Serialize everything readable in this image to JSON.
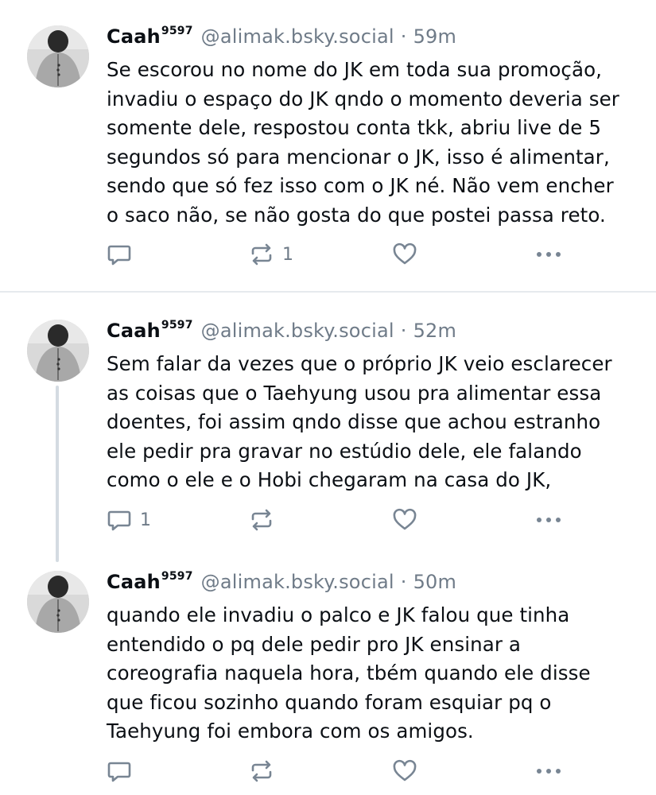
{
  "posts": [
    {
      "author_name": "Caah",
      "author_superscript": "9597",
      "handle": "@alimak.bsky.social",
      "separator": "·",
      "time": "59m",
      "lines": [
        "Se escorou no nome do JK em toda sua promoção,",
        "invadiu o espaço do JK qndo o momento deveria ser",
        "somente dele, respostou conta tkk, abriu live de 5",
        "segundos só para mencionar o JK, isso é alimentar,",
        "sendo que só fez isso com o JK né. Não vem encher",
        "o saco não, se não gosta do que postei passa reto."
      ],
      "reply_count": "",
      "repost_count": "1",
      "like_count": ""
    },
    {
      "author_name": "Caah",
      "author_superscript": "9597",
      "handle": "@alimak.bsky.social",
      "separator": "·",
      "time": "52m",
      "lines": [
        "Sem falar da vezes que o próprio JK veio esclarecer",
        "as coisas que o Taehyung usou pra alimentar essa",
        "doentes, foi assim qndo disse que achou estranho",
        "ele pedir pra gravar no estúdio dele, ele falando",
        "como o ele e o Hobi chegaram na casa do JK,"
      ],
      "reply_count": "1",
      "repost_count": "",
      "like_count": ""
    },
    {
      "author_name": "Caah",
      "author_superscript": "9597",
      "handle": "@alimak.bsky.social",
      "separator": "·",
      "time": "50m",
      "lines": [
        "quando ele invadiu o palco e JK falou que tinha",
        "entendido o pq dele pedir pro JK ensinar a",
        "coreografia naquela hora, tbém quando ele disse",
        "que ficou sozinho quando foram esquiar pq o",
        "Taehyung foi embora com os amigos."
      ],
      "reply_count": "",
      "repost_count": "",
      "like_count": ""
    }
  ],
  "icons": {
    "reply": "reply-icon",
    "repost": "repost-icon",
    "like": "heart-icon",
    "more": "more-icon"
  },
  "colors": {
    "text": "#0b0f14",
    "muted": "#6f7b88",
    "icon": "#788593",
    "thread_line": "#d4dbe2",
    "divider": "#e6eaee"
  }
}
